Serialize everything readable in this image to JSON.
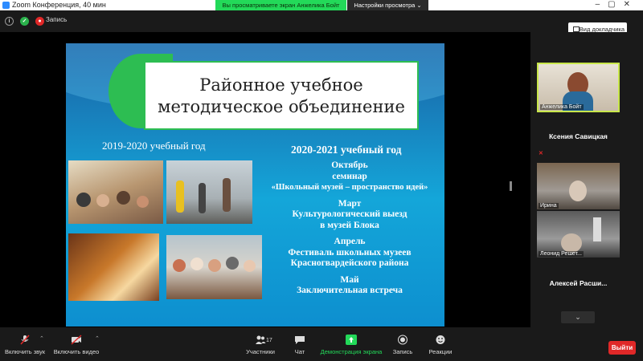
{
  "window": {
    "title": "Zoom Конференция, 40 мин"
  },
  "topbar": {
    "record_label": "Запись",
    "banner": "Вы просматриваете экран Анжелика Бойт",
    "view_settings": "Настройки просмотра ⌄",
    "doc_view": "Вид докладчика"
  },
  "slide": {
    "title_line1": "Районное учебное",
    "title_line2": "методическое объединение",
    "year_left": "2019-2020 учебный год",
    "year_right": "2020-2021 учебный год",
    "events": [
      {
        "lines": [
          "Октябрь",
          "семинар",
          "«Школьный музей – пространство идей»"
        ]
      },
      {
        "lines": [
          "Март",
          "Культурологический выезд",
          "в музей Блока"
        ]
      },
      {
        "lines": [
          "Апрель",
          "Фестиваль школьных музеев",
          "Красногвардейского района"
        ]
      },
      {
        "lines": [
          "Май",
          "Заключительная встреча"
        ]
      }
    ]
  },
  "participants": [
    {
      "name": "Анжелика Бойт",
      "video": true
    },
    {
      "name": "Ксения Савицкая",
      "video": false
    },
    {
      "name": "Ирина",
      "video": true
    },
    {
      "name": "Леонид Решет...",
      "video": true
    },
    {
      "name": "Алексей Расши...",
      "video": false
    }
  ],
  "toolbar": {
    "mic_label": "Включить звук",
    "video_label": "Включить видео",
    "participants_label": "Участники",
    "participants_count": "17",
    "chat_label": "Чат",
    "share_label": "Демонстрация экрана",
    "record_label": "Запись",
    "reactions_label": "Реакции",
    "exit_label": "Выйти"
  },
  "colors": {
    "share_green": "#23d959",
    "exit_red": "#e02828",
    "active_speaker": "#c8e64a"
  }
}
